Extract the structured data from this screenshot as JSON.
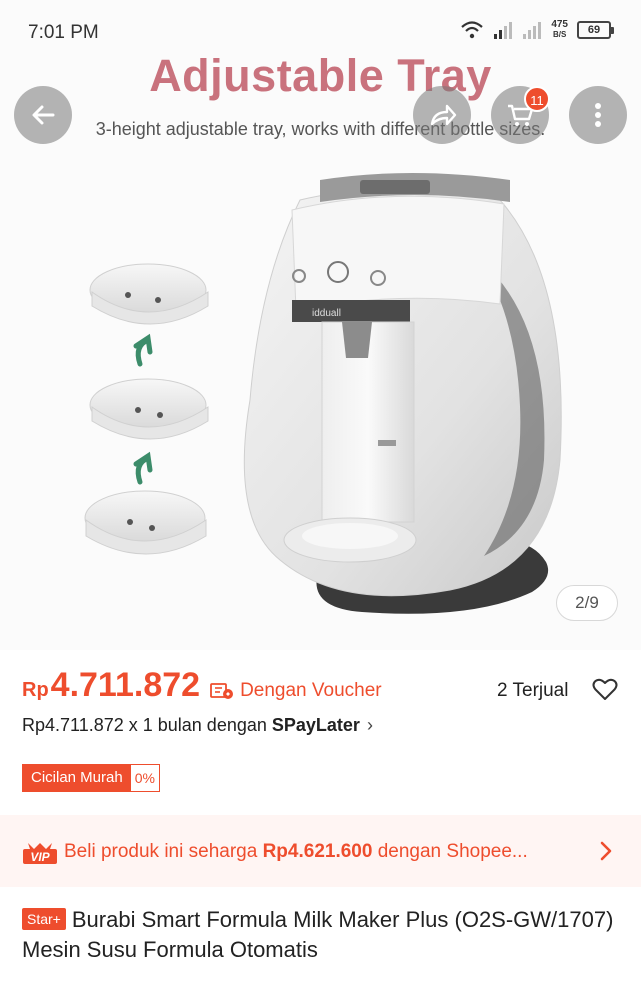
{
  "status_bar": {
    "time": "7:01 PM",
    "net_speed_value": "475",
    "net_speed_unit": "B/S",
    "battery": "69",
    "icons": [
      "wifi-icon",
      "signal-icon",
      "signal-icon-2",
      "battery-icon"
    ]
  },
  "gallery": {
    "headline": "Adjustable Tray",
    "subline": "3-height adjustable tray, works with different bottle sizes.",
    "machine_logo": "idduall",
    "image_counter": "2/9",
    "cart_badge": "11",
    "buttons": [
      "back-icon",
      "share-icon",
      "cart-icon",
      "more-icon"
    ]
  },
  "price": {
    "currency": "Rp",
    "value": "4.711.872",
    "voucher_label": "Dengan Voucher",
    "sold": "2 Terjual"
  },
  "paylater": {
    "text": "Rp4.711.872 x 1 bulan dengan",
    "brand": "SPayLater",
    "chevron": "›"
  },
  "cicilan": {
    "label": "Cicilan Murah",
    "rate": "0%"
  },
  "vip_banner": {
    "badge": "VIP",
    "text_before": "Beli produk ini seharga ",
    "price": "Rp4.621.600",
    "text_after": " dengan Shopee..."
  },
  "title": {
    "badge": "Star+",
    "text": "Burabi Smart Formula Milk Maker Plus (O2S-GW/1707) Mesin Susu Formula Otomatis"
  },
  "colors": {
    "accent": "#ee4d2d",
    "headline": "#c9727d",
    "banner_bg": "#fff5f3"
  }
}
